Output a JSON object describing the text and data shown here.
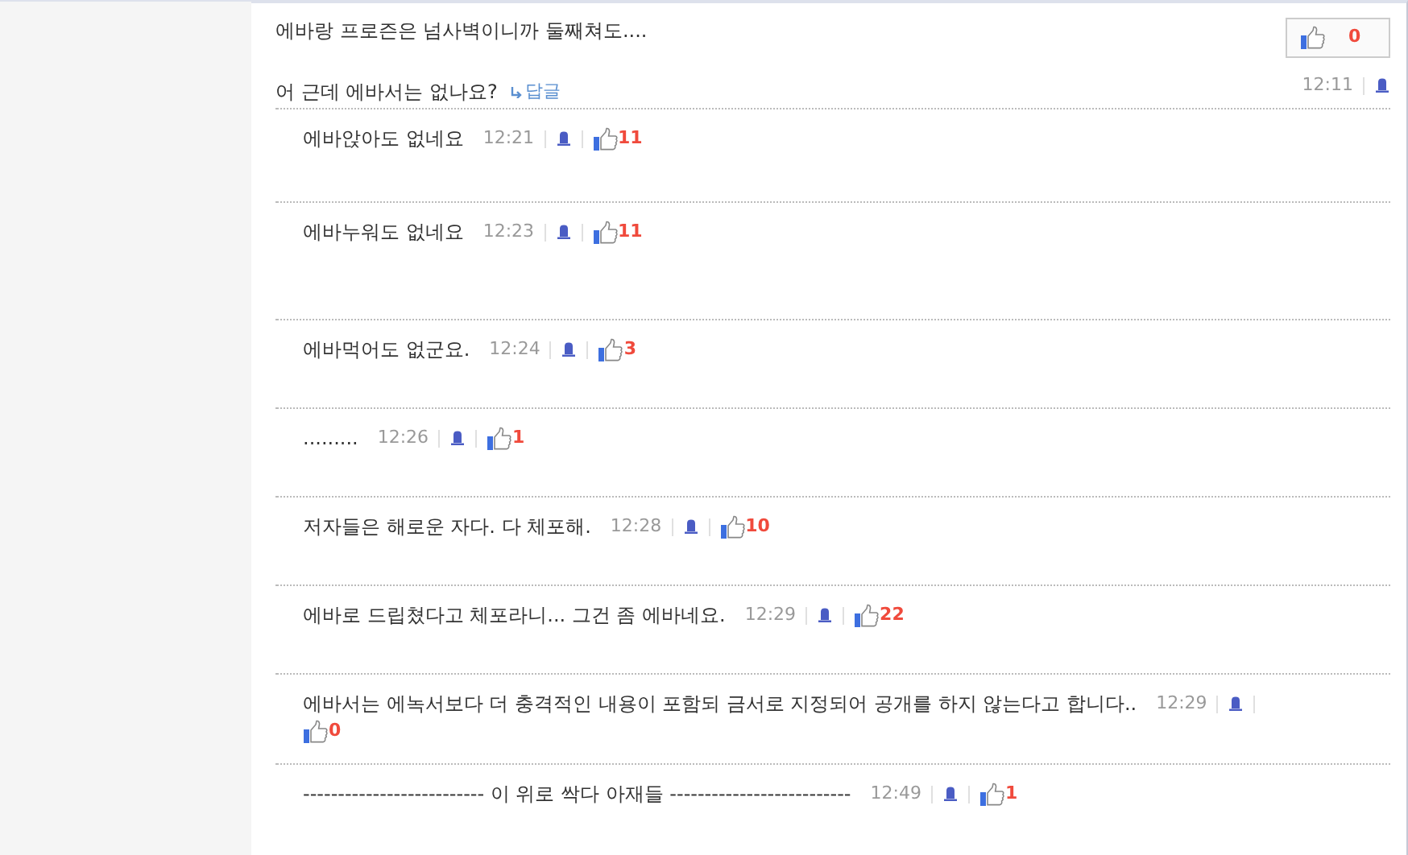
{
  "comment": {
    "lines": [
      "에바랑 프로즌은 넘사벽이니까 둘째쳐도....",
      "어 근데 에바서는 없나요?"
    ],
    "reply_link": "답글",
    "likes": "0",
    "time": "12:11"
  },
  "replies": [
    {
      "text": "에바앉아도 없네요",
      "time": "12:21",
      "likes": "11"
    },
    {
      "text": "에바누워도 없네요",
      "time": "12:23",
      "likes": "11"
    },
    {
      "text": "에바먹어도 없군요.",
      "time": "12:24",
      "likes": "3"
    },
    {
      "text": ".........",
      "time": "12:26",
      "likes": "1"
    },
    {
      "text": "저자들은 해로운 자다. 다 체포해.",
      "time": "12:28",
      "likes": "10"
    },
    {
      "text": "에바로 드립쳤다고 체포라니... 그건 좀 에바네요.",
      "time": "12:29",
      "likes": "22"
    },
    {
      "text": "에바서는 에녹서보다 더 충격적인 내용이 포함되 금서로 지정되어 공개를 하지 않는다고 합니다..",
      "time": "12:29",
      "likes": "0"
    },
    {
      "text": "-------------------------- 이 위로 싹다 아재들 --------------------------",
      "time": "12:49",
      "likes": "1"
    }
  ]
}
